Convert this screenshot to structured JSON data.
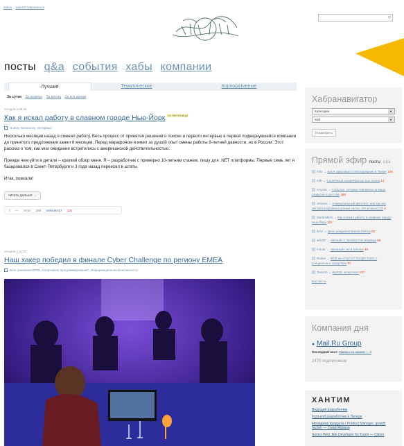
{
  "toplinks": [
    "войти",
    "зарегистрироваться"
  ],
  "logo": "ХАБРАХАБР",
  "nav": {
    "active": "посты",
    "links": [
      "q&a",
      "события",
      "хабы",
      "компании"
    ]
  },
  "tabs": [
    "Лучшие",
    "Тематические",
    "Корпоративные"
  ],
  "subtabs": [
    "За сутки",
    "За неделю",
    "За месяц",
    "За всё время"
  ],
  "post1": {
    "time": "сегодня в 09:28",
    "title": "Как я искал работу в славном городе Нью-Йорк",
    "badge": "из песочницы",
    "hubs": "Human Resources, Интервью",
    "p1": "Несколько месяцев назад я сменил работу. Весь процесс от принятия решения о поиске и первого интервью в первой подвернувшейся компании до принятого предложения занял 8 месяцев. Перед марафоном я имел за душой опыт смены работы 8-летней давности, но в России. Этот рассказ о том, как мои ожидания встретились с американской действительностью.",
    "p2": "Прежде чем уйти в детали – краткий обзор меня. Я – разработчик с примерно 10-летним стажем, пишу для .NET платформы. Первые семь лет я базировался в Санкт-Петербурге и 3 года назад переехал в штаты.",
    "p3": "Итак, поехали!",
    "readmore": "читать дальше →",
    "votes": "—",
    "views": "тетат",
    "comments": "286",
    "author": "unknown17",
    "favs": "115"
  },
  "post2": {
    "time": "сегодня в 11:32",
    "title": "Наш хакер победил в финале Cyber Challenge по региону EMEA",
    "hubs": "Блог компании КРОК, Спортивное программирование*, Информационная безопасность*"
  },
  "navigator": {
    "title": "Хабранавигатор",
    "cat": "Категория",
    "hub": "Хаб",
    "button": "Посмотреть"
  },
  "live": {
    "title": "Прямой эфир",
    "tab_posts": "посты",
    "tab_qa": "q&a",
    "items": [
      {
        "user": "Flint",
        "text": "Как я заваливал собеседование в Twitter",
        "n": "106"
      },
      {
        "user": "mtb",
        "text": "Солнечный концентратор Sun Simba",
        "n": "14"
      },
      {
        "user": "rcrystal",
        "text": "События, которые повлияли на ваше развитие в детстве",
        "n": "489"
      },
      {
        "user": "x6sums",
        "text": "Универсальный автотест, или как мы автоматизировали ручные тесты. API в nanoCAD",
        "n": "3"
      },
      {
        "user": "MartinMiles",
        "text": "Как я искал работу в славном городе Нью-Йорк",
        "n": "119"
      },
      {
        "user": "RAZ",
        "text": "День рождения Билла Гейтса",
        "n": "83"
      },
      {
        "user": "arbi3D",
        "text": "Квенийн с прохвостом медведя",
        "n": "69"
      },
      {
        "user": "Innuar",
        "text": "«Венный» же в Service",
        "n": "48"
      },
      {
        "user": "Roime",
        "text": "ФСБ не отпустит Google Glass с специальных средствах",
        "n": "67"
      },
      {
        "user": "TanArto",
        "text": "MySQL шпаргалко",
        "n": "227"
      }
    ],
    "more": "все посты"
  },
  "company": {
    "title": "Компания дня",
    "name": "Mail.Ru Group",
    "last_label": "Последний пост:",
    "last": "Хакеры на экране — 2",
    "subs": "2470 подписчиков"
  },
  "hunt": {
    "title": "ХАНТИМ",
    "jobs": [
      "Ведущий разработчик",
      "front-end разработчик в Питере",
      "Менеджер продукта / Product Manager, growth hacker — СмартАфиша",
      "Senior Web JEE Developer for Kuoni — Cikum"
    ]
  },
  "colors": {
    "link": "#336699",
    "accent": "#f6b800"
  }
}
